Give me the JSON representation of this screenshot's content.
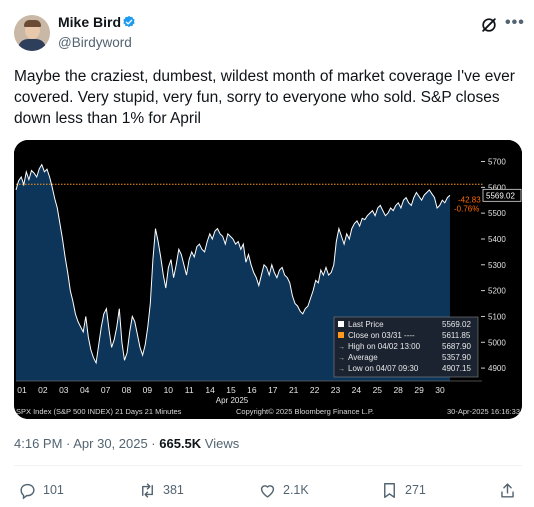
{
  "author": {
    "name": "Mike Bird",
    "handle": "@Birdyword"
  },
  "tweet": {
    "text": "Maybe the craziest, dumbest, wildest month of market coverage I've ever covered. Very stupid, very fun, sorry to everyone who sold. S&P closes down less than 1% for April"
  },
  "meta": {
    "time": "4:16 PM · Apr 30, 2025 · ",
    "views_count": "665.5K",
    "views_label": " Views"
  },
  "actions": {
    "replies": "101",
    "reposts": "381",
    "likes": "2.1K",
    "bookmarks": "271"
  },
  "colors": {
    "accent": "#1d9bf0",
    "chart_bg": "#000000",
    "chart_fill": "#0c3559",
    "price_line": "#ffffff",
    "ref_line": "#ff9a1f",
    "down": "#ff6a00"
  },
  "chart_data": {
    "type": "area",
    "x_ticks": [
      "01",
      "02",
      "03",
      "04",
      "07",
      "08",
      "09",
      "10",
      "11",
      "14",
      "15",
      "16",
      "17",
      "21",
      "22",
      "23",
      "24",
      "25",
      "28",
      "29",
      "30"
    ],
    "x_month_label": "Apr 2025",
    "ylim": [
      4850,
      5760
    ],
    "y_ticks": [
      "5700",
      "5600",
      "5500",
      "5400",
      "5300",
      "5200",
      "5100",
      "5000",
      "4900"
    ],
    "reference_close": 5611.85,
    "last_price_label": "5569.02",
    "change_points": "-42.83",
    "change_pct": "-0.76%",
    "legend": [
      {
        "label": "Last Price",
        "value": "5569.02"
      },
      {
        "label": "Close on 03/31 ---- ",
        "value": "5611.85"
      },
      {
        "label": "High on 04/02 13:00",
        "value": "5687.90"
      },
      {
        "label": "Average",
        "value": "5357.90"
      },
      {
        "label": "Low on 04/07 09:30",
        "value": "4907.15"
      }
    ],
    "series": [
      {
        "values": [
          5590,
          5625,
          5640,
          5610,
          5660,
          5630,
          5665,
          5655,
          5640,
          5672,
          5688,
          5660,
          5670,
          5640,
          5600,
          5555,
          5520,
          5460,
          5400,
          5330,
          5270,
          5200,
          5160,
          5110,
          5080,
          5060,
          5040,
          5100,
          5020,
          4970,
          4940,
          4920,
          4990,
          5060,
          5110,
          5130,
          5050,
          4980,
          5010,
          5060,
          5130,
          5000,
          4930,
          4960,
          5040,
          5100,
          5080,
          5030,
          4980,
          4950,
          4990,
          5060,
          5150,
          5320,
          5440,
          5390,
          5330,
          5260,
          5210,
          5290,
          5320,
          5250,
          5300,
          5360,
          5340,
          5300,
          5260,
          5320,
          5350,
          5330,
          5370,
          5380,
          5360,
          5350,
          5390,
          5420,
          5400,
          5430,
          5440,
          5420,
          5410,
          5380,
          5420,
          5410,
          5400,
          5380,
          5390,
          5360,
          5380,
          5310,
          5340,
          5300,
          5270,
          5250,
          5220,
          5260,
          5300,
          5290,
          5260,
          5300,
          5270,
          5250,
          5280,
          5290,
          5260,
          5250,
          5230,
          5180,
          5150,
          5140,
          5120,
          5110,
          5130,
          5140,
          5170,
          5200,
          5240,
          5230,
          5280,
          5260,
          5290,
          5260,
          5270,
          5300,
          5390,
          5440,
          5410,
          5380,
          5420,
          5400,
          5440,
          5460,
          5470,
          5450,
          5480,
          5475,
          5490,
          5500,
          5510,
          5490,
          5520,
          5530,
          5510,
          5490,
          5500,
          5520,
          5510,
          5530,
          5540,
          5520,
          5550,
          5560,
          5540,
          5530,
          5560,
          5580,
          5565,
          5550,
          5570,
          5580,
          5590,
          5575,
          5560,
          5520,
          5530,
          5550,
          5540,
          5560,
          5569
        ]
      }
    ],
    "footer_left": "SPX Index (S&P 500 INDEX) 21 Days 21 Minutes",
    "footer_mid": "Copyright© 2025 Bloomberg Finance L.P.",
    "footer_right": "30-Apr-2025 16:16:33"
  }
}
